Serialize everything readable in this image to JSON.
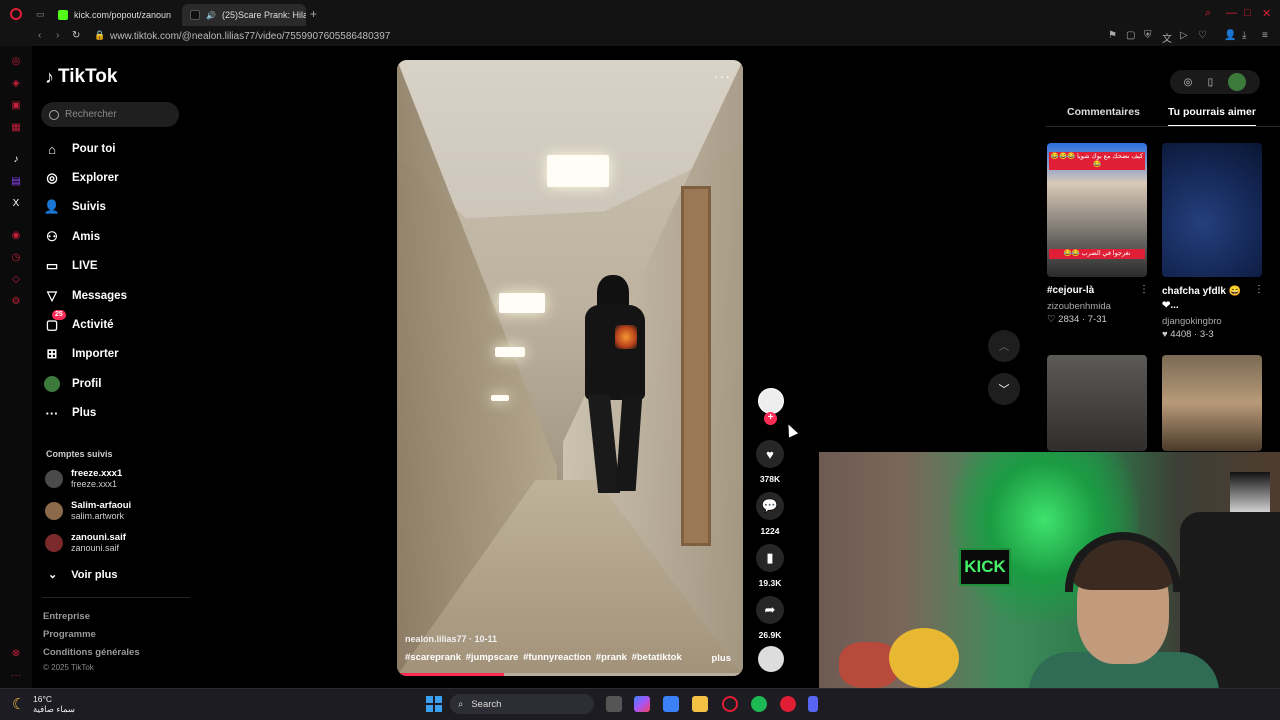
{
  "browser": {
    "tabs": [
      {
        "title": "kick.com/popout/zanoun"
      },
      {
        "title": "(25)Scare Prank: Hila"
      }
    ],
    "url": "www.tiktok.com/@nealon.lilias77/video/7559907605586480397"
  },
  "sidebar": {
    "logo": "TikTok",
    "search_placeholder": "Rechercher",
    "nav": [
      {
        "label": "Pour toi",
        "icon": "home-icon"
      },
      {
        "label": "Explorer",
        "icon": "compass-icon"
      },
      {
        "label": "Suivis",
        "icon": "following-icon"
      },
      {
        "label": "Amis",
        "icon": "friends-icon"
      },
      {
        "label": "LIVE",
        "icon": "live-icon"
      },
      {
        "label": "Messages",
        "icon": "messages-icon"
      },
      {
        "label": "Activité",
        "icon": "activity-icon",
        "badge": "25"
      },
      {
        "label": "Importer",
        "icon": "upload-icon"
      },
      {
        "label": "Profil",
        "icon": "profile-avatar"
      },
      {
        "label": "Plus",
        "icon": "more-icon"
      }
    ],
    "following_title": "Comptes suivis",
    "accounts": [
      {
        "name": "freeze.xxx1",
        "handle": "freeze.xxx1"
      },
      {
        "name": "Salim-arfaoui",
        "handle": "salim.artwork"
      },
      {
        "name": "zanouni.saif",
        "handle": "zanouni.saif"
      }
    ],
    "see_more": "Voir plus",
    "footer_links": [
      "Entreprise",
      "Programme",
      "Conditions générales"
    ],
    "copyright": "© 2025 TikTok"
  },
  "video": {
    "author_date": "nealon.lilias77 · 10-11",
    "hashtags": "#scareprank #jumpscare #funnyreaction #prank #betatiktok",
    "more": "plus",
    "progress": 0.31
  },
  "actions": {
    "likes": "378K",
    "comments": "1224",
    "saves": "19.3K",
    "shares": "26.9K"
  },
  "right_panel": {
    "tabs": [
      "Commentaires",
      "Tu pourrais aimer"
    ],
    "active_tab": "Tu pourrais aimer",
    "cards": [
      {
        "title": "#cejour-là",
        "user": "zizoubenhmida",
        "likes": "2834",
        "date": "7-31",
        "tag_top": "كيف نضحك مع بوك شويا 😂😂😂😂",
        "tag_bottom": "نغرجوا في الضرب 😂😂"
      },
      {
        "title": "chafcha yfdlk 😄 ❤...",
        "user": "djangokingbro",
        "likes": "4408",
        "date": "3-3"
      }
    ]
  },
  "webcam": {
    "sign": "KICK"
  },
  "taskbar": {
    "temperature": "16°C",
    "weather": "سماء صافية",
    "search": "Search"
  }
}
